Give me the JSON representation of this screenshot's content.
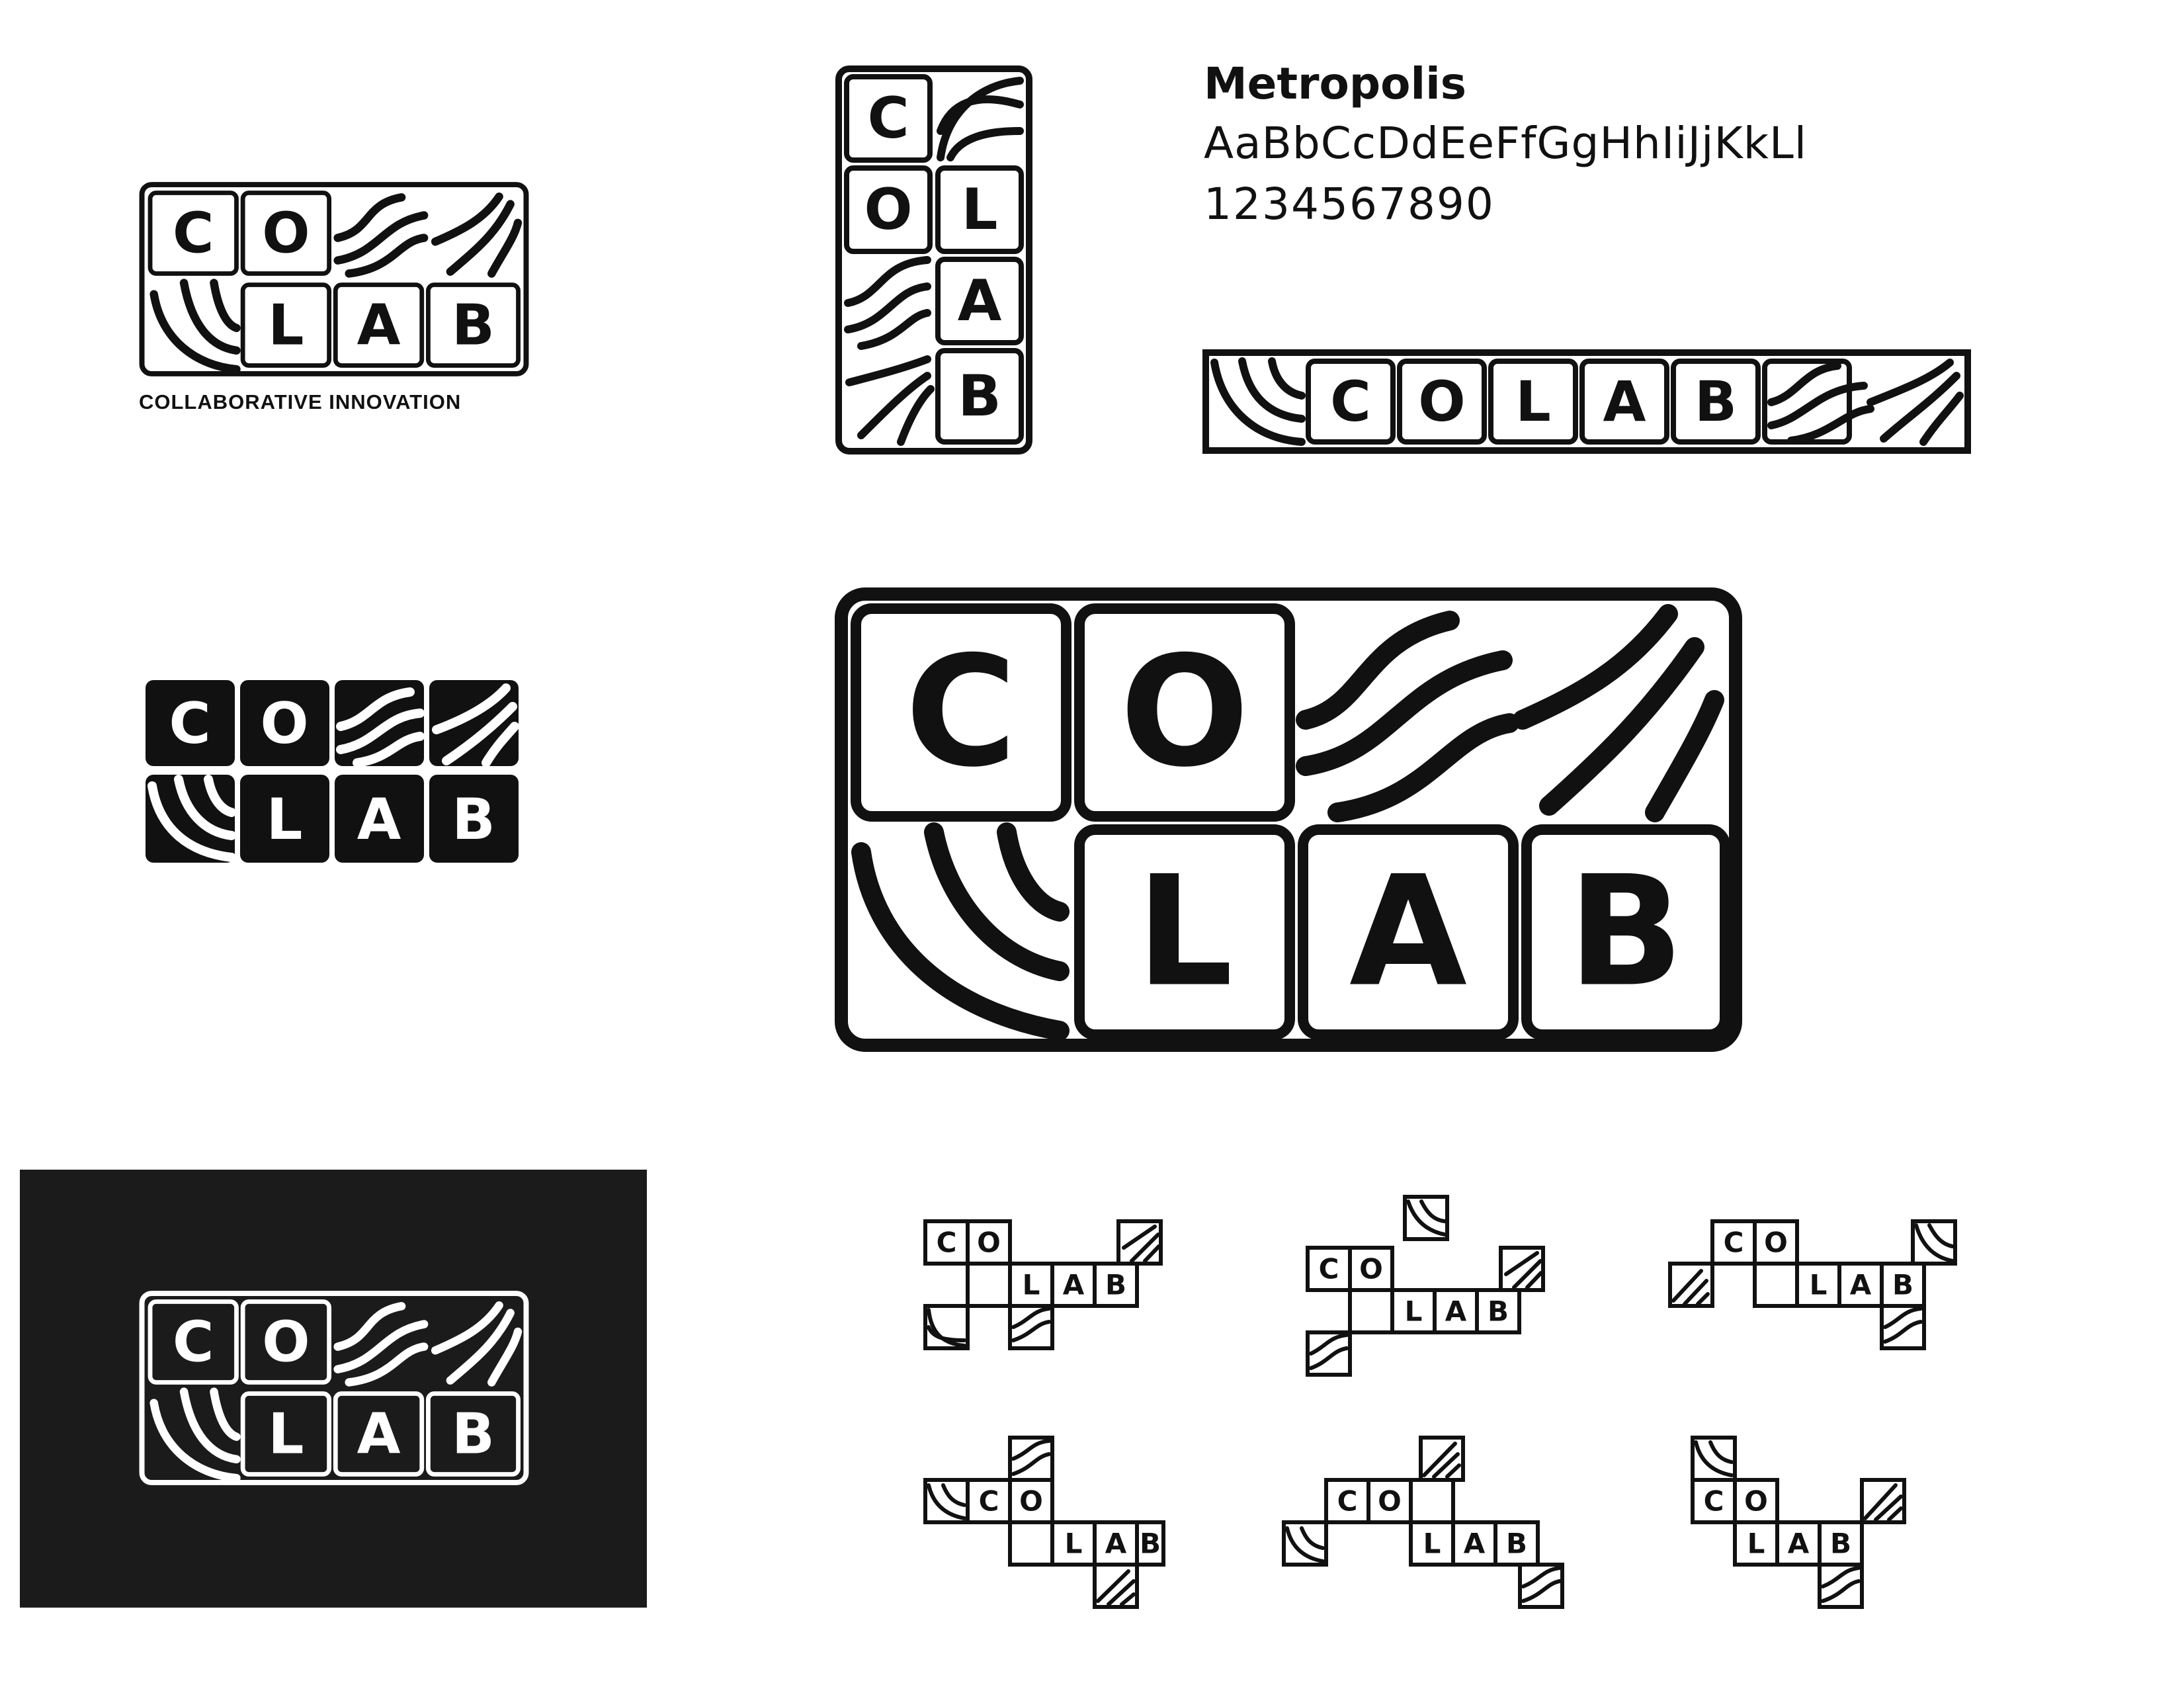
{
  "brand": {
    "name": "COLAB",
    "tagline": "COLLABORATIVE INNOVATION",
    "letters": [
      "C",
      "O",
      "L",
      "A",
      "B"
    ]
  },
  "typography": {
    "font_name": "Metropolis",
    "alphabet_sample": "AaBbCcDdEeFfGgHhIiJjKkLl",
    "digits_sample": "1234567890"
  },
  "colors": {
    "ink": "#111111",
    "paper": "#ffffff",
    "dark_panel": "#1b1b1c"
  },
  "tile_patterns": [
    "arc-corner-icon",
    "wave-lines-icon",
    "sunburst-rays-icon"
  ]
}
